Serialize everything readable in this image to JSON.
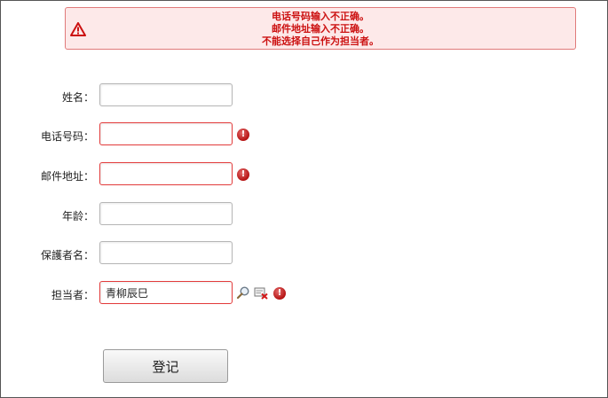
{
  "errors": {
    "messages": [
      "电话号码输入不正确。",
      "邮件地址输入不正确。",
      "不能选择自己作为担当者。"
    ]
  },
  "form": {
    "name": {
      "label": "姓名：",
      "value": ""
    },
    "phone": {
      "label": "电话号码：",
      "value": ""
    },
    "email": {
      "label": "邮件地址：",
      "value": ""
    },
    "age": {
      "label": "年龄：",
      "value": ""
    },
    "guardian": {
      "label": "保護者名：",
      "value": ""
    },
    "assignee": {
      "label": "担当者：",
      "value": "青柳辰巳"
    }
  },
  "submit_label": "登记",
  "colors": {
    "error": "#cc1111",
    "error_bg": "#fde9e9",
    "invalid_border": "#e23a3a"
  },
  "icons": {
    "banner": "warning-triangle-icon",
    "field_error": "error-exclamation-icon",
    "search": "search-icon",
    "clear": "clear-selection-icon"
  }
}
